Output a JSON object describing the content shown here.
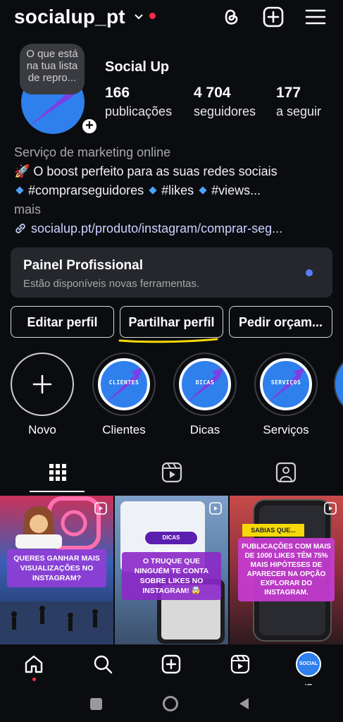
{
  "header": {
    "username": "socialup_pt",
    "icons": [
      "threads-icon",
      "create-icon",
      "menu-icon"
    ]
  },
  "profile": {
    "note": "O que está na tua lista de repro...",
    "display_name": "Social Up",
    "stats": [
      {
        "value": "166",
        "label": "publicações"
      },
      {
        "value": "4 704",
        "label": "seguidores"
      },
      {
        "value": "177",
        "label": "a seguir"
      }
    ],
    "category": "Serviço de marketing online",
    "bio_line1": "🚀 O boost perfeito para as suas redes sociais",
    "hashtags": [
      "#comprarseguidores",
      "#likes",
      "#views..."
    ],
    "more": "mais",
    "link": "socialup.pt/produto/instagram/comprar-seg..."
  },
  "pro_panel": {
    "title": "Painel Profissional",
    "subtitle": "Estão disponíveis novas ferramentas."
  },
  "buttons": {
    "edit": "Editar perfil",
    "share": "Partilhar perfil",
    "quote": "Pedir orçam..."
  },
  "highlights": [
    {
      "label": "Novo",
      "tag": ""
    },
    {
      "label": "Clientes",
      "tag": "CLIENTES"
    },
    {
      "label": "Dicas",
      "tag": "DICAS"
    },
    {
      "label": "Serviços",
      "tag": "SERVIÇOS"
    }
  ],
  "posts": [
    {
      "caption": "Queres ganhar mais visualizações no Instagram?"
    },
    {
      "label": "Dicas Instagram",
      "caption": "O truque que ninguém te conta sobre likes no Instagram! 🤯"
    },
    {
      "label": "Sabias que...",
      "caption": "Publicações com mais de 1000 likes têm 75% mais hipóteses de aparecer na opção explorar do Instagram."
    }
  ],
  "avatar_small_text": "SOCIAL UP",
  "colors": {
    "background": "#0b0c10",
    "accent_blue": "#2f80ed",
    "notification_red": "#ff2b44",
    "link": "#c9d4ff",
    "highlight_yellow": "#f5d90a"
  }
}
